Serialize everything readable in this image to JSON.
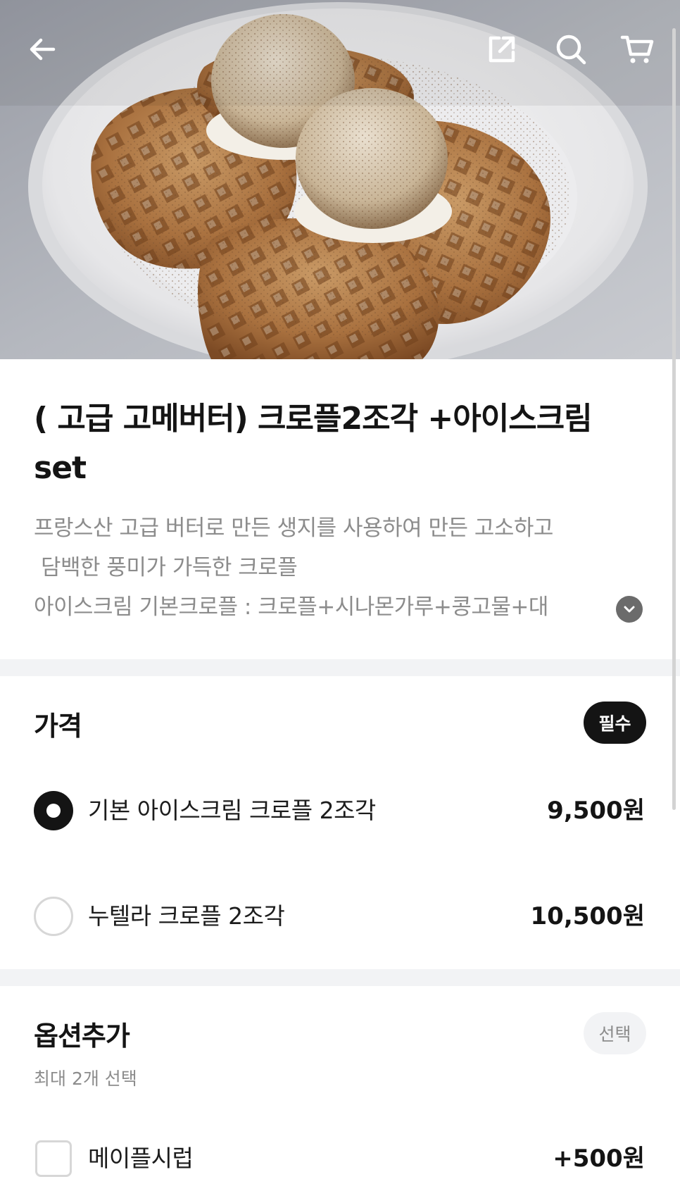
{
  "nav": {
    "back_icon": "arrow-left-icon",
    "share_icon": "share-icon",
    "search_icon": "search-icon",
    "cart_icon": "cart-icon"
  },
  "hero_image": {
    "subject": "croffle waffles with two scoops of ice cream dusted with cinnamon and soybean powder on a white plate"
  },
  "product": {
    "title": "( 고급 고메버터) 크로플2조각 +아이스크림set",
    "description_lines": [
      "프랑스산 고급 버터로 만든 생지를 사용하여 만든 고소하고",
      " 담백한 풍미가 가득한 크로플",
      "아이스크림 기본크로플 : 크로플+시나몬가루+콩고물+대"
    ],
    "expand_icon": "chevron-down-icon"
  },
  "price_section": {
    "title": "가격",
    "badge": "필수",
    "options": [
      {
        "label": "기본 아이스크림 크로플 2조각",
        "price": "9,500원",
        "selected": true
      },
      {
        "label": "누텔라 크로플 2조각",
        "price": "10,500원",
        "selected": false
      }
    ]
  },
  "options_section": {
    "title": "옵션추가",
    "badge": "선택",
    "subtitle": "최대 2개 선택",
    "items": [
      {
        "label": "메이플시럽",
        "price": "+500원",
        "checked": false
      }
    ]
  },
  "colors": {
    "text_primary": "#141414",
    "text_secondary": "#8c8c8c",
    "divider": "#f2f3f5",
    "radio_border": "#d7d7d7"
  }
}
